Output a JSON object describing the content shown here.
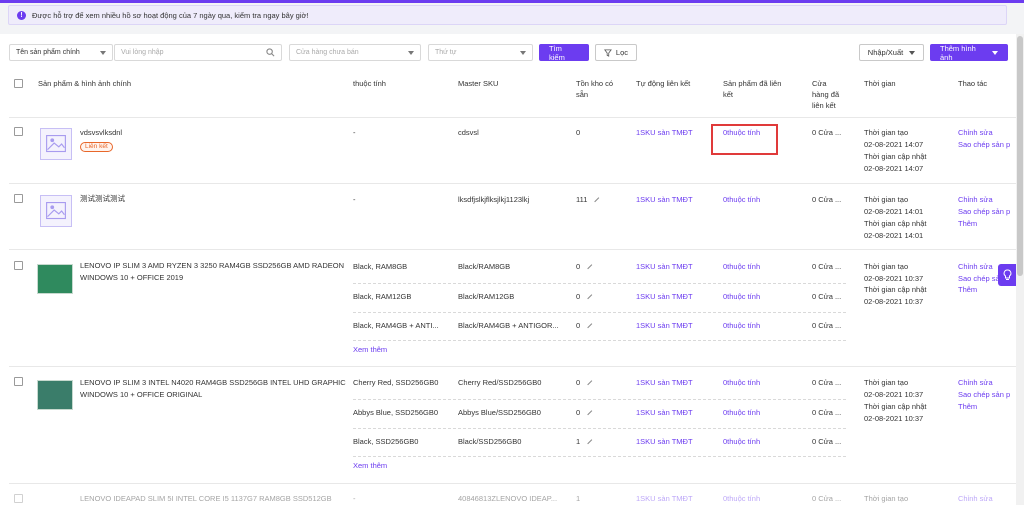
{
  "notice": {
    "text": "Được hỗ trợ để xem nhiều hồ sơ hoạt động của 7 ngày qua, kiểm tra ngay bây giờ!"
  },
  "filters": {
    "field_select": "Tên sản phẩm chính",
    "search_placeholder": "Vui lòng nhập",
    "store_placeholder": "Cửa hàng chưa bán",
    "order_placeholder": "Thứ tự",
    "search_btn": "Tìm kiếm",
    "filter_btn": "Lọc",
    "import_export_btn": "Nhập/Xuất",
    "add_image_btn": "Thêm hình ảnh"
  },
  "headers": {
    "product": "Sản phẩm & hình ảnh chính",
    "attr": "thuộc tính",
    "sku": "Master SKU",
    "stock_l1": "Tồn kho có",
    "stock_l2": "sẵn",
    "autolink": "Tự động liên kết",
    "linked_l1": "Sản phẩm đã liên",
    "linked_l2": "kết",
    "store_l1": "Cửa",
    "store_l2": "hàng đã",
    "store_l3": "liên kết",
    "time": "Thời gian",
    "actions": "Thao tác"
  },
  "common": {
    "created": "Thời gian tạo",
    "updated": "Thời gian cập nhật",
    "edit": "Chỉnh sửa",
    "copy": "Sao chép sản p",
    "more": "Thêm",
    "see_more": "Xem thêm",
    "store_dash": "0 Cửa ...",
    "sku_tmdt": "1SKU sàn TMĐT",
    "zero_attr": "0thuộc tính",
    "linked_tag": "Liên kết"
  },
  "rows": [
    {
      "name": "vdsvsvlksdnl",
      "attr": "-",
      "sku": "cdsvsl",
      "stock": "0",
      "created": "02-08-2021 14:07",
      "updated": "02-08-2021 14:07"
    },
    {
      "name": "测试测试测试",
      "attr": "-",
      "sku": "lksdfjslkjflksjlkj1123lkj",
      "stock": "111",
      "created": "02-08-2021 14:01",
      "updated": "02-08-2021 14:01"
    },
    {
      "name_l1": "LENOVO IP SLIM 3 AMD RYZEN 3 3250 RAM4GB SSD256GB AMD RADEON",
      "name_l2": "WINDOWS 10 + OFFICE 2019",
      "created": "02-08-2021 10:37",
      "updated": "02-08-2021 10:37",
      "variants": [
        {
          "attr": "Black, RAM8GB",
          "sku": "Black/RAM8GB",
          "stock": "0"
        },
        {
          "attr": "Black, RAM12GB",
          "sku": "Black/RAM12GB",
          "stock": "0"
        },
        {
          "attr": "Black, RAM4GB + ANTI...",
          "sku": "Black/RAM4GB + ANTIGOR...",
          "stock": "0"
        }
      ]
    },
    {
      "name_l1": "LENOVO IP SLIM 3 INTEL N4020 RAM4GB SSD256GB INTEL UHD GRAPHIC",
      "name_l2": "WINDOWS 10 + OFFICE ORIGINAL",
      "created": "02-08-2021 10:37",
      "updated": "02-08-2021 10:37",
      "variants": [
        {
          "attr": "Cherry Red, SSD256GB0",
          "sku": "Cherry Red/SSD256GB0",
          "stock": "0"
        },
        {
          "attr": "Abbys Blue, SSD256GB0",
          "sku": "Abbys Blue/SSD256GB0",
          "stock": "0"
        },
        {
          "attr": "Black, SSD256GB0",
          "sku": "Black/SSD256GB0",
          "stock": "1"
        }
      ]
    },
    {
      "name": "LENOVO IDEAPAD SLIM 5I INTEL CORE I5 1137G7 RAM8GB SSD512GB",
      "attr": "-",
      "sku": "40846813ZLENOVO IDEAP...",
      "stock": "1"
    }
  ],
  "colors": {
    "accent": "#6c3cf0",
    "highlight": "#e03a3a",
    "tag": "#e8672a"
  }
}
